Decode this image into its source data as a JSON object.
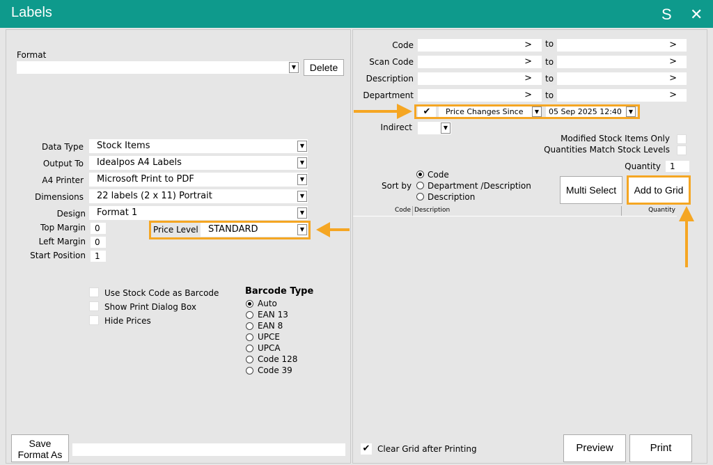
{
  "window": {
    "title": "Labels",
    "s_button": "S",
    "close_glyph": "✕"
  },
  "left": {
    "format_label": "Format",
    "format_value": "",
    "delete_label": "Delete",
    "fields": [
      {
        "label": "Data Type",
        "value": "Stock Items"
      },
      {
        "label": "Output To",
        "value": "Idealpos A4 Labels"
      },
      {
        "label": "A4 Printer",
        "value": "Microsoft Print to PDF"
      },
      {
        "label": "Dimensions",
        "value": "22 labels (2 x 11) Portrait"
      },
      {
        "label": "Design",
        "value": "Format 1"
      }
    ],
    "top_margin_label": "Top Margin",
    "top_margin_value": "0",
    "left_margin_label": "Left Margin",
    "left_margin_value": "0",
    "start_position_label": "Start Position",
    "start_position_value": "1",
    "price_level_label": "Price Level",
    "price_level_value": "STANDARD",
    "checkboxes": [
      {
        "label": "Use Stock Code as Barcode",
        "checked": false
      },
      {
        "label": "Show Print Dialog Box",
        "checked": false
      },
      {
        "label": "Hide Prices",
        "checked": false
      }
    ],
    "barcode_type_title": "Barcode Type",
    "barcode_options": [
      "Auto",
      "EAN 13",
      "EAN 8",
      "UPCE",
      "UPCA",
      "Code 128",
      "Code 39"
    ],
    "barcode_selected": "Auto",
    "save_format_label_1": "Save",
    "save_format_label_2": "Format As",
    "save_format_value": ""
  },
  "right": {
    "filters": [
      {
        "label": "Code",
        "from": ">",
        "to_label": "to",
        "to": ">"
      },
      {
        "label": "Scan Code",
        "from": ">",
        "to_label": "to",
        "to": ">"
      },
      {
        "label": "Description",
        "from": ">",
        "to_label": "to",
        "to": ">"
      },
      {
        "label": "Department",
        "from": ">",
        "to_label": "to",
        "to": ">"
      }
    ],
    "price_changes_checked_glyph": "✔",
    "price_changes_label": "Price Changes Since",
    "price_changes_date": "05 Sep 2025 12:40",
    "indirect_label": "Indirect",
    "indirect_value": "",
    "modified_only_label": "Modified Stock Items Only",
    "quantities_match_label": "Quantities Match Stock Levels",
    "quantity_label": "Quantity",
    "quantity_value": "1",
    "sort_by_label": "Sort by",
    "sort_options": [
      "Code",
      "Department /Description",
      "Description"
    ],
    "sort_selected": "Code",
    "multi_select_label": "Multi Select",
    "add_to_grid_label": "Add to Grid",
    "grid_columns": [
      "Code",
      "Description",
      "Quantity"
    ],
    "clear_grid_label": "Clear Grid after Printing",
    "clear_grid_glyph": "✔",
    "preview_label": "Preview",
    "print_label": "Print"
  },
  "annotation_color": "#f5a623"
}
